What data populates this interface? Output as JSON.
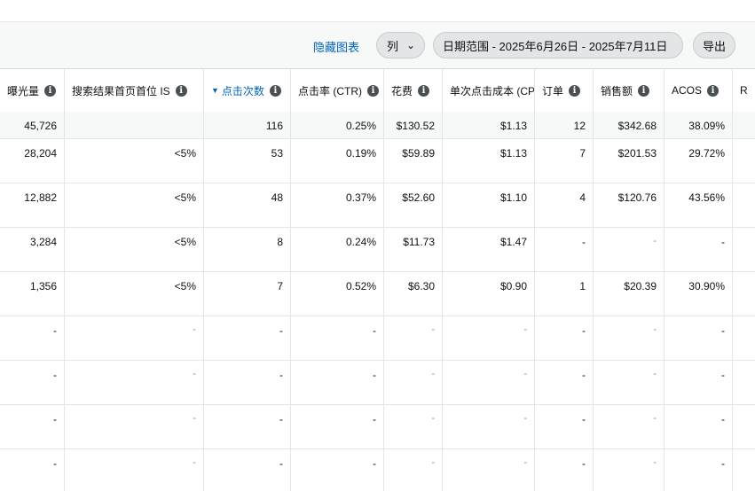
{
  "toolbar": {
    "hide_chart": "隐藏图表",
    "columns_label": "列",
    "date_range_label": "日期范围 - 2025年6月26日 - 2025年7月11日",
    "export_label": "导出"
  },
  "table": {
    "columns": [
      {
        "key": "impr",
        "label": "曝光量",
        "info": true
      },
      {
        "key": "topis",
        "label": "搜索结果首页首位 IS",
        "info": true
      },
      {
        "key": "clicks",
        "label": "点击次数",
        "info": true,
        "sorted": true
      },
      {
        "key": "ctr",
        "label": "点击率 (CTR)",
        "info": true
      },
      {
        "key": "spend",
        "label": "花费",
        "info": true
      },
      {
        "key": "cpc",
        "label": "单次点击成本 (CPC)",
        "info": false
      },
      {
        "key": "orders",
        "label": "订单",
        "info": true
      },
      {
        "key": "sales",
        "label": "销售额",
        "info": true
      },
      {
        "key": "acos",
        "label": "ACOS",
        "info": true
      },
      {
        "key": "extra",
        "label": "R",
        "info": false
      }
    ],
    "total": [
      "45,726",
      "",
      "116",
      "0.25%",
      "$130.52",
      "$1.13",
      "12",
      "$342.68",
      "38.09%",
      ""
    ],
    "rows": [
      [
        "28,204",
        "<5%",
        "53",
        "0.19%",
        "$59.89",
        "$1.13",
        "7",
        "$201.53",
        "29.72%",
        ""
      ],
      [
        "12,882",
        "<5%",
        "48",
        "0.37%",
        "$52.60",
        "$1.10",
        "4",
        "$120.76",
        "43.56%",
        ""
      ],
      [
        "3,284",
        "<5%",
        "8",
        "0.24%",
        "$11.73",
        "$1.47",
        "-",
        "-",
        "-",
        ""
      ],
      [
        "1,356",
        "<5%",
        "7",
        "0.52%",
        "$6.30",
        "$0.90",
        "1",
        "$20.39",
        "30.90%",
        ""
      ],
      [
        "-",
        "-",
        "-",
        "-",
        "-",
        "-",
        "-",
        "-",
        "-",
        ""
      ],
      [
        "-",
        "-",
        "-",
        "-",
        "-",
        "-",
        "-",
        "-",
        "-",
        ""
      ],
      [
        "-",
        "-",
        "-",
        "-",
        "-",
        "-",
        "-",
        "-",
        "-",
        ""
      ],
      [
        "-",
        "-",
        "-",
        "-",
        "-",
        "-",
        "-",
        "-",
        "-",
        ""
      ]
    ]
  }
}
